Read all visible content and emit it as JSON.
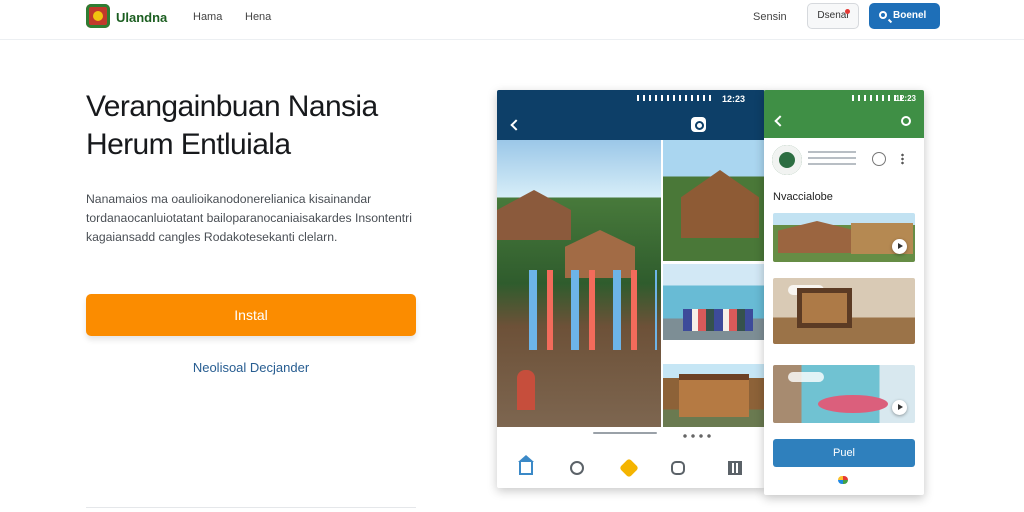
{
  "header": {
    "brand": "Ulandna",
    "nav": [
      "Hama",
      "Hena"
    ],
    "sign_in": "Sensin",
    "secondary_button": "Dsenal",
    "search_button": "Boenel"
  },
  "hero": {
    "title": "Verangainbuan Nansia Herum Entluiala",
    "description": "Nanamaios ma oaulioikanodonerelianica kisainandar tordanaocanluiotatant bailoparanocaniaisakardes Insontentri kagaiansadd cangles Rodakotesekanti clelarn.",
    "install_button": "Instal",
    "secondary_link": "Neolisoal Decjander"
  },
  "phone_one": {
    "time": "12:23",
    "bottom_nav": [
      "home",
      "search",
      "favorites",
      "chat",
      "apps"
    ]
  },
  "phone_two": {
    "time": "12:23",
    "section_title": "Nvaccialobe",
    "primary_button": "Puel"
  }
}
